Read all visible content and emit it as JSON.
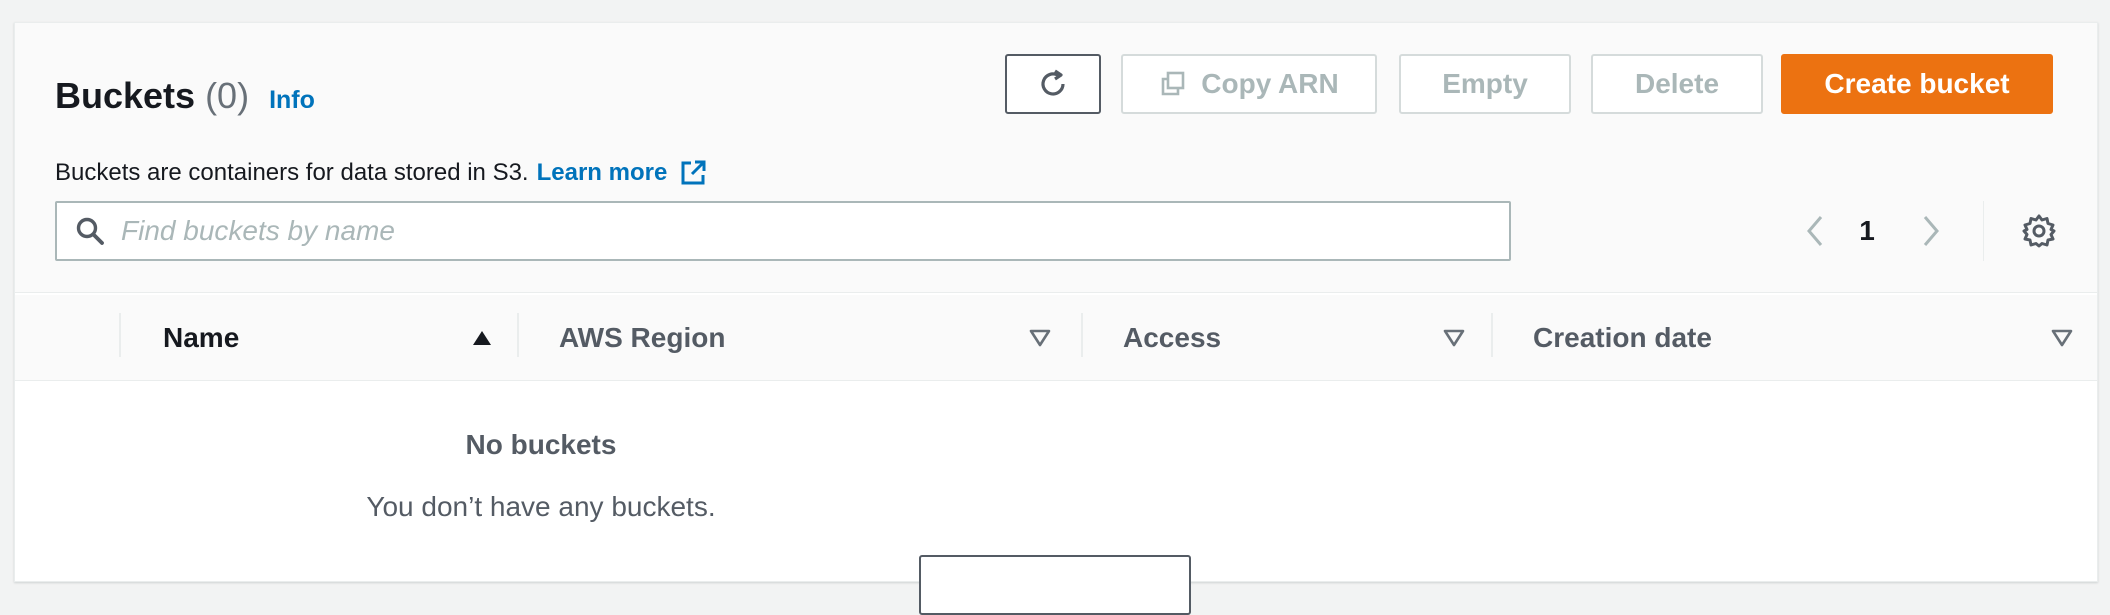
{
  "header": {
    "title": "Buckets",
    "count": "(0)",
    "info": "Info",
    "description": "Buckets are containers for data stored in S3.",
    "learn_more": "Learn more"
  },
  "toolbar": {
    "refresh_icon": "refresh-icon",
    "copy_icon": "copy-icon",
    "copy_arn": "Copy ARN",
    "empty": "Empty",
    "delete": "Delete",
    "create_bucket": "Create bucket"
  },
  "search": {
    "placeholder": "Find buckets by name",
    "value": ""
  },
  "pagination": {
    "current_page": "1"
  },
  "table": {
    "columns": [
      {
        "label": "Name",
        "sort": "ascending"
      },
      {
        "label": "AWS Region",
        "sort": "none"
      },
      {
        "label": "Access",
        "sort": "none"
      },
      {
        "label": "Creation date",
        "sort": "none"
      }
    ],
    "empty_title": "No buckets",
    "empty_description": "You don’t have any buckets."
  },
  "colors": {
    "primary": "#ec7211",
    "link": "#0073bb",
    "disabled_text": "#aab7b8"
  }
}
